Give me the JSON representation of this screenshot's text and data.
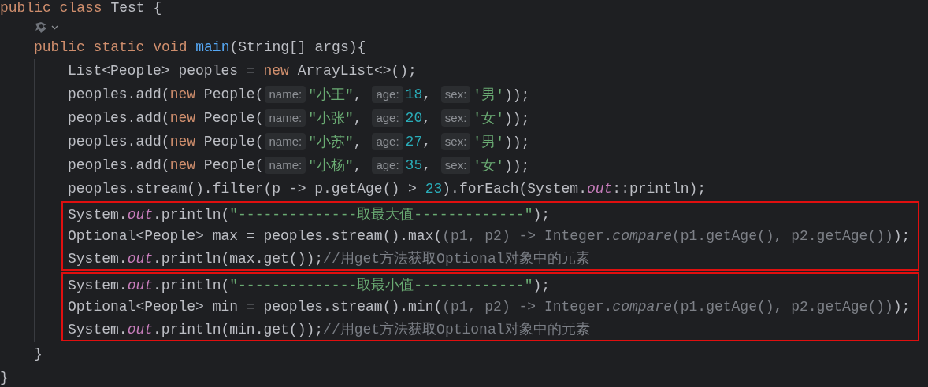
{
  "editor": {
    "code": [
      {
        "kind": "line",
        "tokens": [
          {
            "kind": "kw",
            "text": "public class "
          },
          {
            "kind": "plain",
            "text": "Test {"
          }
        ],
        "children": [
          {
            "kind": "icon_line"
          },
          {
            "kind": "line",
            "tokens": [
              {
                "kind": "kw",
                "text": "public static void "
              },
              {
                "kind": "fn",
                "text": "main"
              },
              {
                "kind": "plain",
                "text": "(String[] args){"
              }
            ],
            "children": [
              {
                "kind": "line",
                "tokens": [
                  {
                    "kind": "plain",
                    "text": "List<People> peoples = "
                  },
                  {
                    "kind": "kw",
                    "text": "new "
                  },
                  {
                    "kind": "plain",
                    "text": "ArrayList<>();"
                  }
                ]
              },
              {
                "kind": "line",
                "tokens": [
                  {
                    "kind": "plain",
                    "text": "peoples.add("
                  },
                  {
                    "kind": "kw",
                    "text": "new "
                  },
                  {
                    "kind": "plain",
                    "text": "People("
                  },
                  {
                    "kind": "hint",
                    "text": "name:"
                  },
                  {
                    "kind": "str",
                    "text": "\"小王\""
                  },
                  {
                    "kind": "plain",
                    "text": ", "
                  },
                  {
                    "kind": "hint",
                    "text": "age:"
                  },
                  {
                    "kind": "num",
                    "text": "18"
                  },
                  {
                    "kind": "plain",
                    "text": ", "
                  },
                  {
                    "kind": "hint",
                    "text": "sex:"
                  },
                  {
                    "kind": "str",
                    "text": "'男'"
                  },
                  {
                    "kind": "plain",
                    "text": "));"
                  }
                ]
              },
              {
                "kind": "line",
                "tokens": [
                  {
                    "kind": "plain",
                    "text": "peoples.add("
                  },
                  {
                    "kind": "kw",
                    "text": "new "
                  },
                  {
                    "kind": "plain",
                    "text": "People("
                  },
                  {
                    "kind": "hint",
                    "text": "name:"
                  },
                  {
                    "kind": "str",
                    "text": "\"小张\""
                  },
                  {
                    "kind": "plain",
                    "text": ", "
                  },
                  {
                    "kind": "hint",
                    "text": "age:"
                  },
                  {
                    "kind": "num",
                    "text": "20"
                  },
                  {
                    "kind": "plain",
                    "text": ", "
                  },
                  {
                    "kind": "hint",
                    "text": "sex:"
                  },
                  {
                    "kind": "str",
                    "text": "'女'"
                  },
                  {
                    "kind": "plain",
                    "text": "));"
                  }
                ]
              },
              {
                "kind": "line",
                "tokens": [
                  {
                    "kind": "plain",
                    "text": "peoples.add("
                  },
                  {
                    "kind": "kw",
                    "text": "new "
                  },
                  {
                    "kind": "plain",
                    "text": "People("
                  },
                  {
                    "kind": "hint",
                    "text": "name:"
                  },
                  {
                    "kind": "str",
                    "text": "\"小苏\""
                  },
                  {
                    "kind": "plain",
                    "text": ", "
                  },
                  {
                    "kind": "hint",
                    "text": "age:"
                  },
                  {
                    "kind": "num",
                    "text": "27"
                  },
                  {
                    "kind": "plain",
                    "text": ", "
                  },
                  {
                    "kind": "hint",
                    "text": "sex:"
                  },
                  {
                    "kind": "str",
                    "text": "'男'"
                  },
                  {
                    "kind": "plain",
                    "text": "));"
                  }
                ]
              },
              {
                "kind": "line",
                "tokens": [
                  {
                    "kind": "plain",
                    "text": "peoples.add("
                  },
                  {
                    "kind": "kw",
                    "text": "new "
                  },
                  {
                    "kind": "plain",
                    "text": "People("
                  },
                  {
                    "kind": "hint",
                    "text": "name:"
                  },
                  {
                    "kind": "str",
                    "text": "\"小杨\""
                  },
                  {
                    "kind": "plain",
                    "text": ", "
                  },
                  {
                    "kind": "hint",
                    "text": "age:"
                  },
                  {
                    "kind": "num",
                    "text": "35"
                  },
                  {
                    "kind": "plain",
                    "text": ", "
                  },
                  {
                    "kind": "hint",
                    "text": "sex:"
                  },
                  {
                    "kind": "str",
                    "text": "'女'"
                  },
                  {
                    "kind": "plain",
                    "text": "));"
                  }
                ]
              },
              {
                "kind": "line",
                "tokens": [
                  {
                    "kind": "plain",
                    "text": "peoples.stream().filter(p -> p.getAge() > "
                  },
                  {
                    "kind": "num",
                    "text": "23"
                  },
                  {
                    "kind": "plain",
                    "text": ").forEach(System."
                  },
                  {
                    "kind": "field",
                    "text": "out"
                  },
                  {
                    "kind": "plain",
                    "text": "::println);"
                  }
                ]
              },
              {
                "kind": "box",
                "lines": [
                  {
                    "kind": "line",
                    "tokens": [
                      {
                        "kind": "plain",
                        "text": "System."
                      },
                      {
                        "kind": "field",
                        "text": "out"
                      },
                      {
                        "kind": "plain",
                        "text": ".println("
                      },
                      {
                        "kind": "str",
                        "text": "\"--------------取最大值-------------\""
                      },
                      {
                        "kind": "plain",
                        "text": ");"
                      }
                    ]
                  },
                  {
                    "kind": "line",
                    "tokens": [
                      {
                        "kind": "plain",
                        "text": "Optional<People> max = peoples.stream().max("
                      },
                      {
                        "kind": "dim",
                        "text": "(p1, p2) -> Integer."
                      },
                      {
                        "kind": "dim_italic",
                        "text": "compare"
                      },
                      {
                        "kind": "dim",
                        "text": "(p1.getAge(), p2.getAge())"
                      },
                      {
                        "kind": "plain",
                        "text": ");"
                      }
                    ]
                  },
                  {
                    "kind": "line",
                    "tokens": [
                      {
                        "kind": "plain",
                        "text": "System."
                      },
                      {
                        "kind": "field",
                        "text": "out"
                      },
                      {
                        "kind": "plain",
                        "text": ".println(max.get());"
                      },
                      {
                        "kind": "comment",
                        "text": "//用get方法获取Optional对象中的元素"
                      }
                    ]
                  }
                ]
              },
              {
                "kind": "box",
                "lines": [
                  {
                    "kind": "line",
                    "tokens": [
                      {
                        "kind": "plain",
                        "text": "System."
                      },
                      {
                        "kind": "field",
                        "text": "out"
                      },
                      {
                        "kind": "plain",
                        "text": ".println("
                      },
                      {
                        "kind": "str",
                        "text": "\"--------------取最小值-------------\""
                      },
                      {
                        "kind": "plain",
                        "text": ");"
                      }
                    ]
                  },
                  {
                    "kind": "line",
                    "tokens": [
                      {
                        "kind": "plain",
                        "text": "Optional<People> min = peoples.stream().min("
                      },
                      {
                        "kind": "dim",
                        "text": "(p1, p2) -> Integer."
                      },
                      {
                        "kind": "dim_italic",
                        "text": "compare"
                      },
                      {
                        "kind": "dim",
                        "text": "(p1.getAge(), p2.getAge())"
                      },
                      {
                        "kind": "plain",
                        "text": ");"
                      }
                    ]
                  },
                  {
                    "kind": "line",
                    "tokens": [
                      {
                        "kind": "plain",
                        "text": "System."
                      },
                      {
                        "kind": "field",
                        "text": "out"
                      },
                      {
                        "kind": "plain",
                        "text": ".println(min.get());"
                      },
                      {
                        "kind": "comment",
                        "text": "//用get方法获取Optional对象中的元素"
                      }
                    ]
                  }
                ]
              }
            ],
            "close": "}"
          }
        ],
        "close": "}"
      }
    ]
  }
}
